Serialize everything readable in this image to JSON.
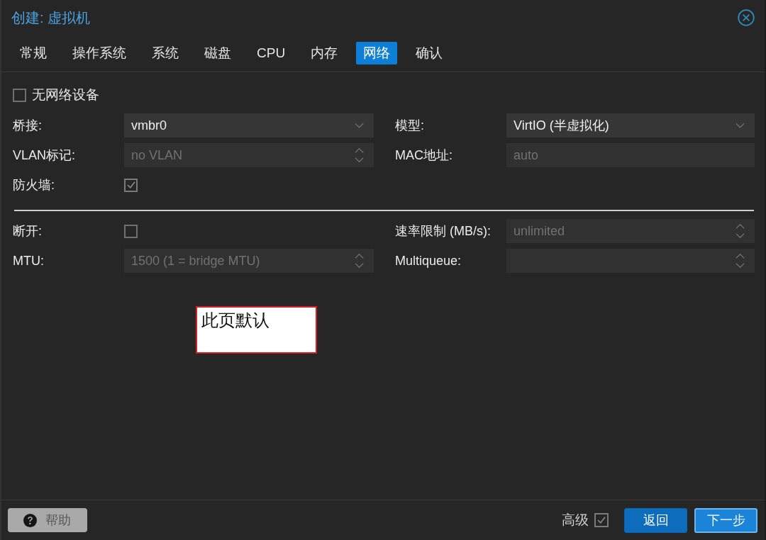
{
  "window": {
    "title": "创建: 虚拟机"
  },
  "tabs": [
    {
      "label": "常规",
      "selected": false
    },
    {
      "label": "操作系统",
      "selected": false
    },
    {
      "label": "系统",
      "selected": false
    },
    {
      "label": "磁盘",
      "selected": false
    },
    {
      "label": "CPU",
      "selected": false
    },
    {
      "label": "内存",
      "selected": false
    },
    {
      "label": "网络",
      "selected": true
    },
    {
      "label": "确认",
      "selected": false
    }
  ],
  "no_network_device": {
    "label": "无网络设备",
    "checked": false
  },
  "basic": [
    {
      "kind": "select",
      "label": "桥接:",
      "value": "vmbr0"
    },
    {
      "kind": "select",
      "label": "模型:",
      "value": "VirtIO (半虚拟化)"
    },
    {
      "kind": "spinner",
      "label": "VLAN标记:",
      "placeholder": "no VLAN"
    },
    {
      "kind": "text",
      "label": "MAC地址:",
      "placeholder": "auto"
    },
    {
      "kind": "checkbox",
      "label": "防火墙:",
      "checked": true
    }
  ],
  "advanced": [
    {
      "kind": "checkbox",
      "label": "断开:",
      "checked": false
    },
    {
      "kind": "spinner",
      "label": "速率限制 (MB/s):",
      "placeholder": "unlimited"
    },
    {
      "kind": "spinner",
      "label": "MTU:",
      "placeholder": "1500 (1 = bridge MTU)"
    },
    {
      "kind": "spinner",
      "label": "Multiqueue:"
    }
  ],
  "annotation": {
    "text": "此页默认"
  },
  "footer": {
    "help_button": "帮助",
    "advanced": {
      "label": "高级",
      "checked": true
    },
    "buttons": [
      {
        "label": "返回",
        "focused": false
      },
      {
        "label": "下一步",
        "focused": true
      }
    ]
  }
}
